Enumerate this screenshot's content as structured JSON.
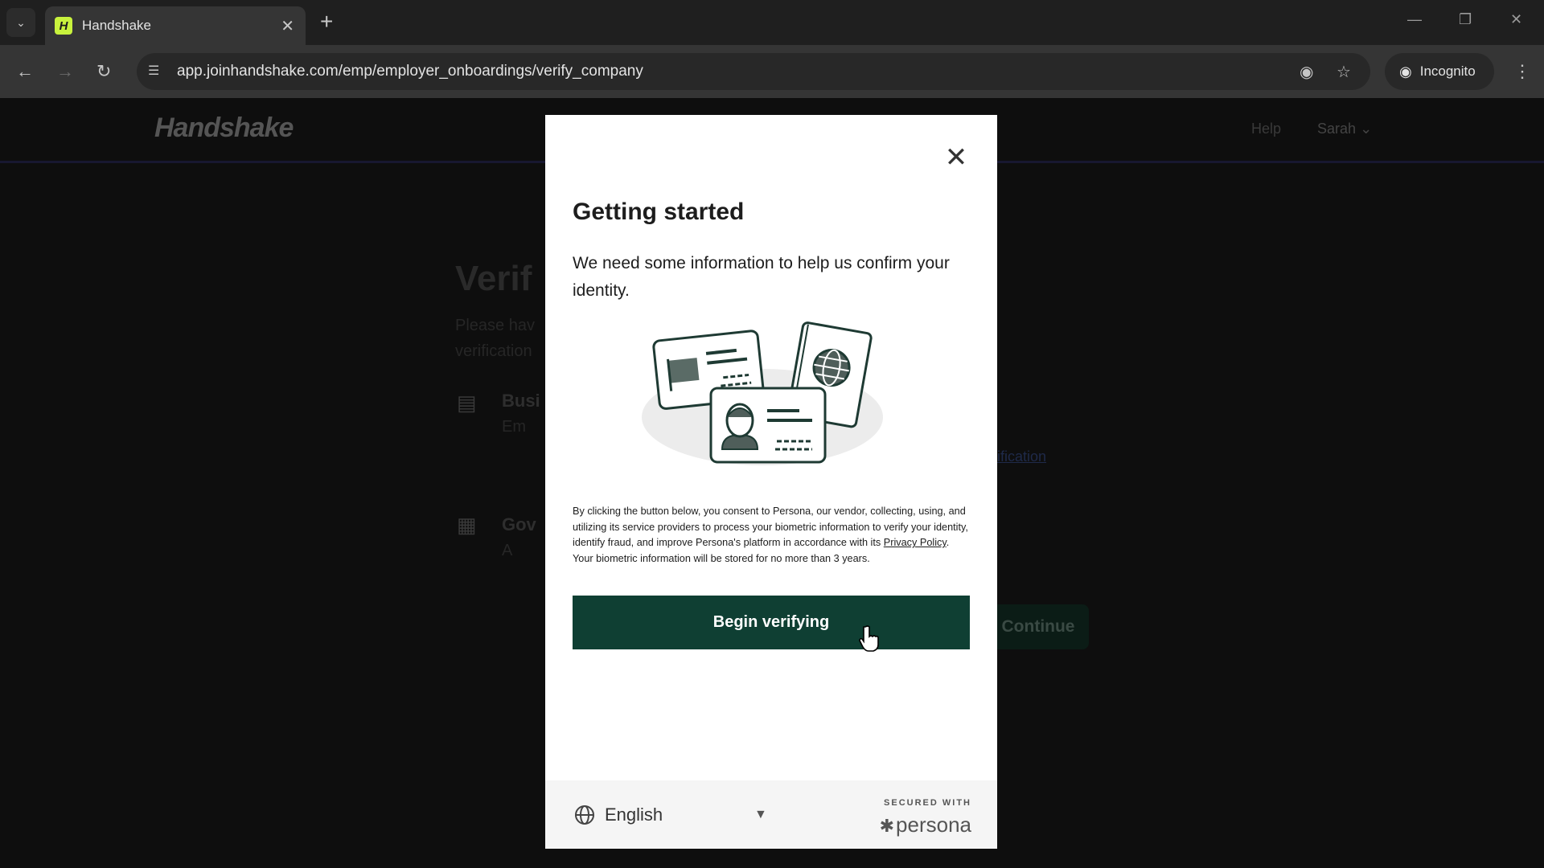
{
  "browser": {
    "tab_title": "Handshake",
    "favicon_letter": "H",
    "url": "app.joinhandshake.com/emp/employer_onboardings/verify_company",
    "incognito_label": "Incognito"
  },
  "background_page": {
    "logo": "Handshake",
    "help_link": "Help",
    "user_menu": "Sarah",
    "heading_partial": "Verif",
    "subtitle_line1_partial": "Please hav",
    "subtitle_line2_partial": "verification",
    "item1_partial": "Busi",
    "item1_sub_partial": "Em",
    "item2_partial": "Gov",
    "item2_sub_partial": "A",
    "link_partial": "ification",
    "continue_button": "Continue"
  },
  "modal": {
    "title": "Getting started",
    "subtitle": "We need some information to help us confirm your identity.",
    "consent_before": "By clicking the button below, you consent to Persona, our vendor, collecting, using, and utilizing its service providers to process your biometric information to verify your identity, identify fraud, and improve Persona's platform in accordance with its ",
    "privacy_link": "Privacy Policy",
    "consent_after": ". Your biometric information will be stored for no more than 3 years.",
    "begin_button": "Begin verifying",
    "language": "English",
    "secured_with": "SECURED WITH",
    "brand": "persona",
    "primary_color": "#0f3f33"
  }
}
